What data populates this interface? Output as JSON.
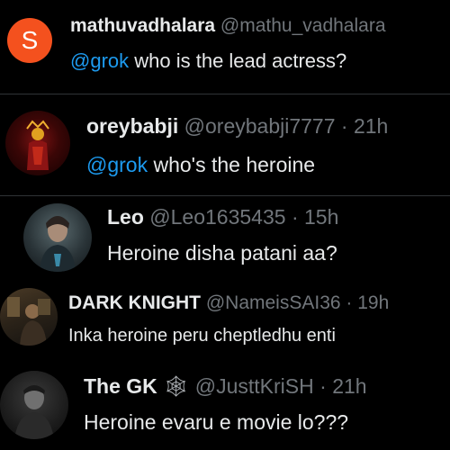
{
  "posts": [
    {
      "display_name": "mathuvadhalara",
      "handle": "@mathu_vadhalara",
      "time": "",
      "avatar_letter": "S",
      "avatar_color": "#f4511e",
      "mention": "@grok",
      "text": " who is the lead actress?"
    },
    {
      "display_name": "oreybabji",
      "handle": "@oreybabji7777",
      "time": "· 21h",
      "mention": "@grok",
      "text": " who's the heroine"
    },
    {
      "display_name": "Leo",
      "handle": "@Leo1635435",
      "time": "· 15h",
      "text": "Heroine disha patani aa?"
    },
    {
      "display_name": "DARK KNIGHT",
      "handle": "@NameisSAI36",
      "time": "· 19h",
      "text": "Inka heroine peru cheptledhu enti"
    },
    {
      "display_name": "The GK",
      "badge": "🕸",
      "handle": "@JusttKriSH",
      "time": "· 21h",
      "text": "Heroine evaru e movie lo???"
    }
  ],
  "colors": {
    "background": "#000000",
    "text": "#e7e9ea",
    "secondary": "#71767b",
    "mention": "#1d9bf0",
    "divider": "#2f3336"
  }
}
